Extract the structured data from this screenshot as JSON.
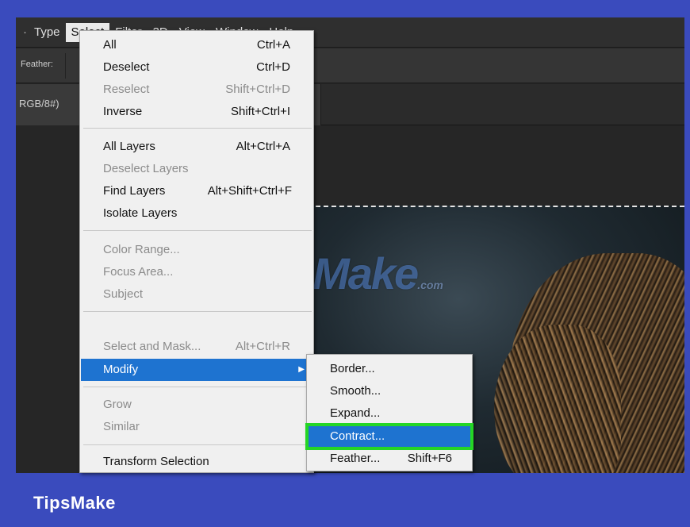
{
  "menubar": {
    "lead": "·",
    "items": [
      {
        "label": "Type"
      },
      {
        "label": "Select"
      },
      {
        "label": "Filter"
      },
      {
        "label": "3D"
      },
      {
        "label": "View"
      },
      {
        "label": "Window"
      },
      {
        "label": "Help"
      }
    ]
  },
  "optbar": {
    "feather_label": "Feather:"
  },
  "doctab": {
    "label": "RGB/8#)"
  },
  "watermark": {
    "text": "TipsMake",
    "suffix": ".com"
  },
  "select_menu": {
    "items": [
      {
        "label": "All",
        "shortcut": "Ctrl+A"
      },
      {
        "label": "Deselect",
        "shortcut": "Ctrl+D"
      },
      {
        "label": "Reselect",
        "shortcut": "Shift+Ctrl+D"
      },
      {
        "label": "Inverse",
        "shortcut": "Shift+Ctrl+I"
      },
      {
        "label": "All Layers",
        "shortcut": "Alt+Ctrl+A"
      },
      {
        "label": "Deselect Layers",
        "shortcut": ""
      },
      {
        "label": "Find Layers",
        "shortcut": "Alt+Shift+Ctrl+F"
      },
      {
        "label": "Isolate Layers",
        "shortcut": ""
      },
      {
        "label": "Color Range...",
        "shortcut": ""
      },
      {
        "label": "Focus Area...",
        "shortcut": ""
      },
      {
        "label": "Subject",
        "shortcut": ""
      },
      {
        "label": "Select and Mask...",
        "shortcut": "Alt+Ctrl+R"
      },
      {
        "label": "Modify",
        "shortcut": ""
      },
      {
        "label": "Grow",
        "shortcut": ""
      },
      {
        "label": "Similar",
        "shortcut": ""
      },
      {
        "label": "Transform Selection",
        "shortcut": ""
      }
    ],
    "submenu_arrow": "▶"
  },
  "modify_submenu": {
    "items": [
      {
        "label": "Border...",
        "shortcut": ""
      },
      {
        "label": "Smooth...",
        "shortcut": ""
      },
      {
        "label": "Expand...",
        "shortcut": ""
      },
      {
        "label": "Contract...",
        "shortcut": ""
      },
      {
        "label": "Feather...",
        "shortcut": "Shift+F6"
      }
    ]
  },
  "footer": {
    "brand": "TipsMake"
  },
  "colors": {
    "highlight": "#1e73d0",
    "callout": "#25d625",
    "frame": "#3a4bbd"
  }
}
